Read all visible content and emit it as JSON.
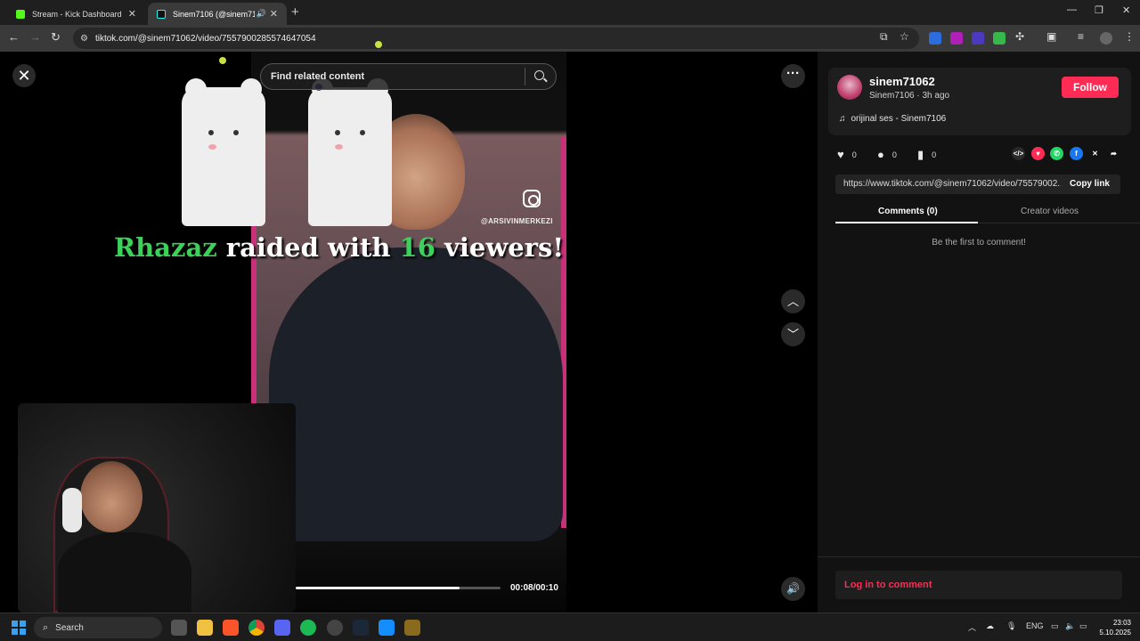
{
  "browser": {
    "tabs": [
      {
        "title": "Stream - Kick Dashboard",
        "icon": "kick-icon",
        "active": false
      },
      {
        "title": "Sinem7106 (@sinem71062)",
        "icon": "tiktok-icon",
        "active": true
      }
    ],
    "new_tab": "+",
    "url": "tiktok.com/@sinem71062/video/7557900285574647054"
  },
  "player": {
    "search_placeholder": "Find related content",
    "watermark": "@ARSIVINMERKEZI",
    "time": "00:08/00:10",
    "progress": 0.8
  },
  "stream_overlay": {
    "raid_name": "Rhazaz",
    "raid_text1": " raided with ",
    "raid_count": "16",
    "raid_text2": " viewers!"
  },
  "profile": {
    "username": "sinem71062",
    "subline": "Sinem7106 · 3h ago",
    "follow_label": "Follow",
    "music": "orijinal ses - Sinem7106"
  },
  "stats": {
    "likes": "0",
    "comments": "0",
    "saves": "0"
  },
  "share": {
    "link": "https://www.tiktok.com/@sinem71062/video/75579002...",
    "copy_label": "Copy link"
  },
  "comments": {
    "tab_comments": "Comments (0)",
    "tab_creator": "Creator videos",
    "empty_text": "Be the first to comment!",
    "login_label": "Log in to comment"
  },
  "taskbar": {
    "search_label": "Search",
    "lang": "ENG",
    "time": "23:03",
    "date": "5.10.2025"
  },
  "colors": {
    "accent": "#fe2c55",
    "raid_green": "#3bd15a"
  }
}
